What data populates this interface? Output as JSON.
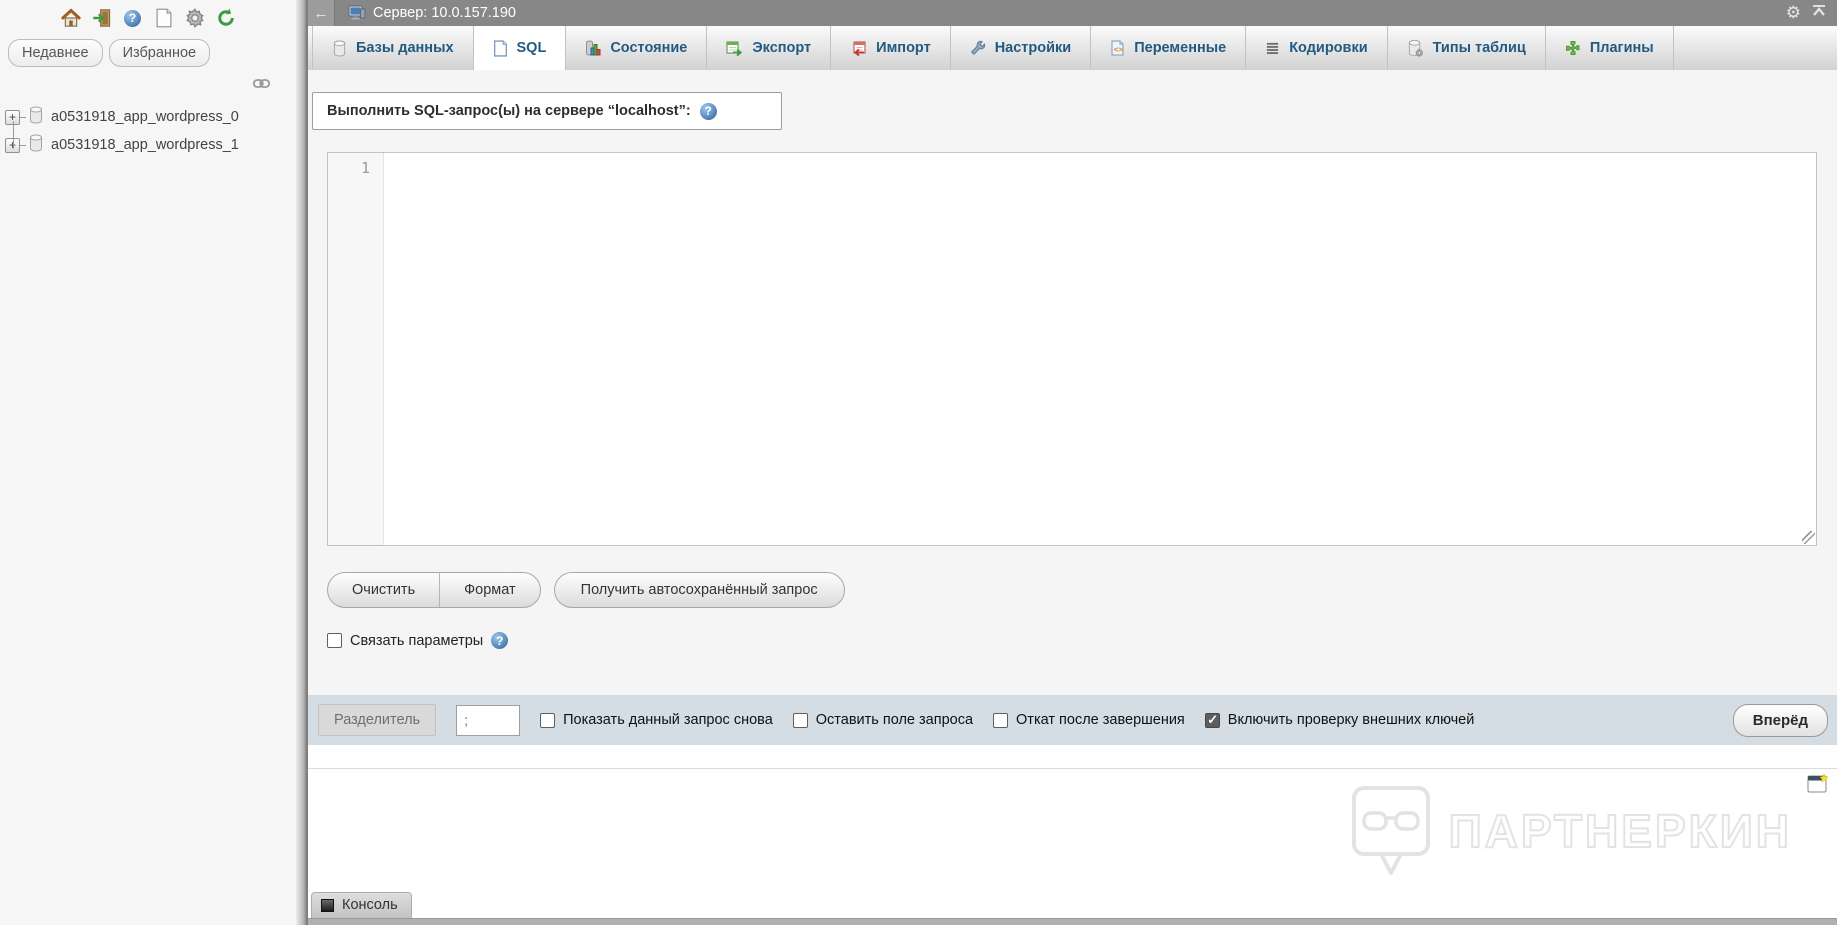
{
  "colors": {
    "accent_blue": "#235a81",
    "topbar_grey": "#878787",
    "footerbar_blue": "#d4dde3",
    "sidebar_grey": "#f6f6f6"
  },
  "sidebar": {
    "toolbar_icons": [
      "home-icon",
      "logout-icon",
      "help-icon",
      "docs-icon",
      "settings-icon",
      "refresh-icon"
    ],
    "tabs": [
      {
        "label": "Недавнее"
      },
      {
        "label": "Избранное"
      }
    ],
    "link_icon": "link-icon",
    "tree": [
      {
        "expander": "+",
        "label": "a0531918_app_wordpress_0"
      },
      {
        "expander": "+",
        "label": "a0531918_app_wordpress_1"
      }
    ]
  },
  "header": {
    "back_arrow": "←",
    "server_label": "Сервер: 10.0.157.190",
    "right_icons": [
      "settings-gear-icon",
      "collapse-top-icon"
    ],
    "gear_glyph": "⚙"
  },
  "tabs": [
    {
      "label": "Базы данных",
      "icon": "database-icon",
      "active": false
    },
    {
      "label": "SQL",
      "icon": "sql-page-icon",
      "active": true
    },
    {
      "label": "Состояние",
      "icon": "status-chart-icon",
      "active": false
    },
    {
      "label": "Экспорт",
      "icon": "export-icon",
      "active": false
    },
    {
      "label": "Импорт",
      "icon": "import-icon",
      "active": false
    },
    {
      "label": "Настройки",
      "icon": "wrench-icon",
      "active": false
    },
    {
      "label": "Переменные",
      "icon": "variables-icon",
      "active": false
    },
    {
      "label": "Кодировки",
      "icon": "charsets-icon",
      "active": false
    },
    {
      "label": "Типы таблиц",
      "icon": "engines-icon",
      "active": false
    },
    {
      "label": "Плагины",
      "icon": "plugins-icon",
      "active": false
    }
  ],
  "query": {
    "legend": "Выполнить SQL-запрос(ы) на сервере “localhost”:",
    "editor": {
      "line_number": "1",
      "content": ""
    },
    "buttons": [
      {
        "label": "Очистить"
      },
      {
        "label": "Формат"
      },
      {
        "label": "Получить автосохранённый запрос"
      }
    ],
    "bind_params": {
      "label": "Связать параметры",
      "checked": false
    }
  },
  "footer": {
    "delimiter_label": "Разделитель",
    "delimiter_value": ";",
    "options": [
      {
        "label": "Показать данный запрос снова",
        "checked": false
      },
      {
        "label": "Оставить поле запроса",
        "checked": false
      },
      {
        "label": "Откат после завершения",
        "checked": false
      },
      {
        "label": "Включить проверку внешних ключей",
        "checked": true
      }
    ],
    "submit_label": "Вперёд"
  },
  "watermark": {
    "text": "ПАРТНЕРКИН"
  },
  "console": {
    "label": "Консоль"
  }
}
